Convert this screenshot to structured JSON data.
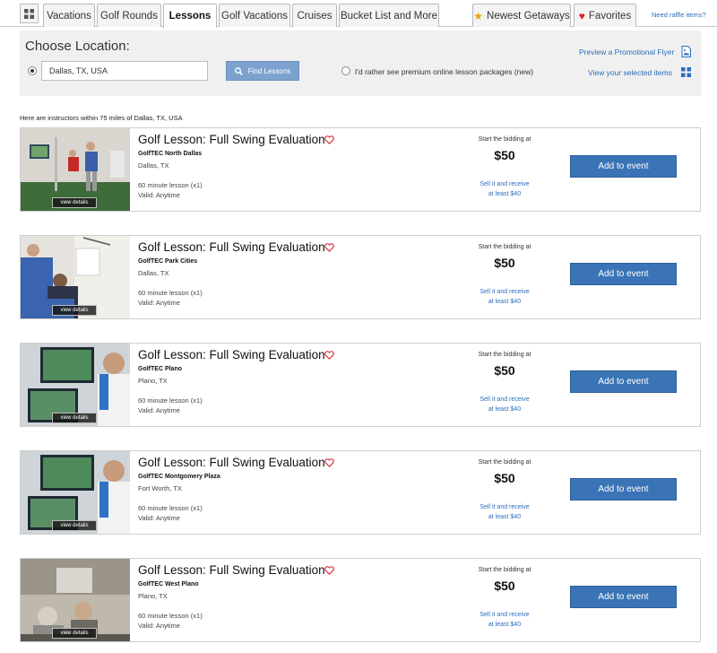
{
  "tabs": [
    {
      "label": "Vacations"
    },
    {
      "label": "Golf Rounds"
    },
    {
      "label": "Lessons"
    },
    {
      "label": "Golf Vacations"
    },
    {
      "label": "Cruises"
    },
    {
      "label": "Bucket List and More"
    }
  ],
  "right_tabs": {
    "newest": "Newest Getaways",
    "favorites": "Favorites"
  },
  "raffle_link": "Need raffle items?",
  "location": {
    "title": "Choose Location:",
    "input_value": "Dallas, TX, USA",
    "find_button": "Find Lessons",
    "premium_label": "I'd rather see premium online lesson packages (new)",
    "promo_link": "Preview a Promotional Flyer",
    "selected_link": "View your selected items"
  },
  "results_caption": "Here are instructors within 75 miles of Dallas, TX, USA",
  "common": {
    "start_label": "Start the bidding at",
    "sell_label_1": "Sell it and receive",
    "sell_label_2": "at least $40",
    "add_button": "Add to event",
    "view_details": "view details"
  },
  "listings": [
    {
      "title": "Golf Lesson: Full Swing Evaluation",
      "vendor": "GolfTEC North Dallas",
      "city": "Dallas, TX",
      "duration": "60 minute lesson (x1)",
      "valid": "Valid: Anytime",
      "price": "$50"
    },
    {
      "title": "Golf Lesson: Full Swing Evaluation",
      "vendor": "GolfTEC Park Cities",
      "city": "Dallas, TX",
      "duration": "60 minute lesson (x1)",
      "valid": "Valid: Anytime",
      "price": "$50"
    },
    {
      "title": "Golf Lesson: Full Swing Evaluation",
      "vendor": "GolfTEC Plano",
      "city": "Plano, TX",
      "duration": "60 minute lesson (x1)",
      "valid": "Valid: Anytime",
      "price": "$50"
    },
    {
      "title": "Golf Lesson: Full Swing Evaluation",
      "vendor": "GolfTEC Montgomery Plaza",
      "city": "Fort Worth, TX",
      "duration": "60 minute lesson (x1)",
      "valid": "Valid: Anytime",
      "price": "$50"
    },
    {
      "title": "Golf Lesson: Full Swing Evaluation",
      "vendor": "GolfTEC West Plano",
      "city": "Plano, TX",
      "duration": "60 minute lesson (x1)",
      "valid": "Valid: Anytime",
      "price": "$50"
    }
  ],
  "colors": {
    "accent_blue": "#3a74b6",
    "link_blue": "#2a6ebb",
    "favorite_red": "#d8202a",
    "star_gold": "#e8a317"
  }
}
